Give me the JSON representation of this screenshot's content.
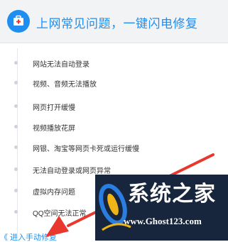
{
  "header": {
    "title": "上网常见问题，一键闪电修复",
    "icon": "first-aid-kit-icon",
    "accent_color": "#1e8ef0"
  },
  "problems": [
    "网站无法自动登录",
    "视频、音频无法播放",
    "网页打开缓慢",
    "视频播放花屏",
    "网银、淘宝等网页卡死或运行缓慢",
    "无法自动登录或网页异常",
    "虚拟内存问题",
    "QQ空间无法正常"
  ],
  "footer": {
    "fix_link": "《 进入手动修复"
  },
  "watermark": {
    "name": "系统之家",
    "url": "www.Ghost123.com"
  },
  "annotation": {
    "arrow_color": "#e8372c"
  }
}
